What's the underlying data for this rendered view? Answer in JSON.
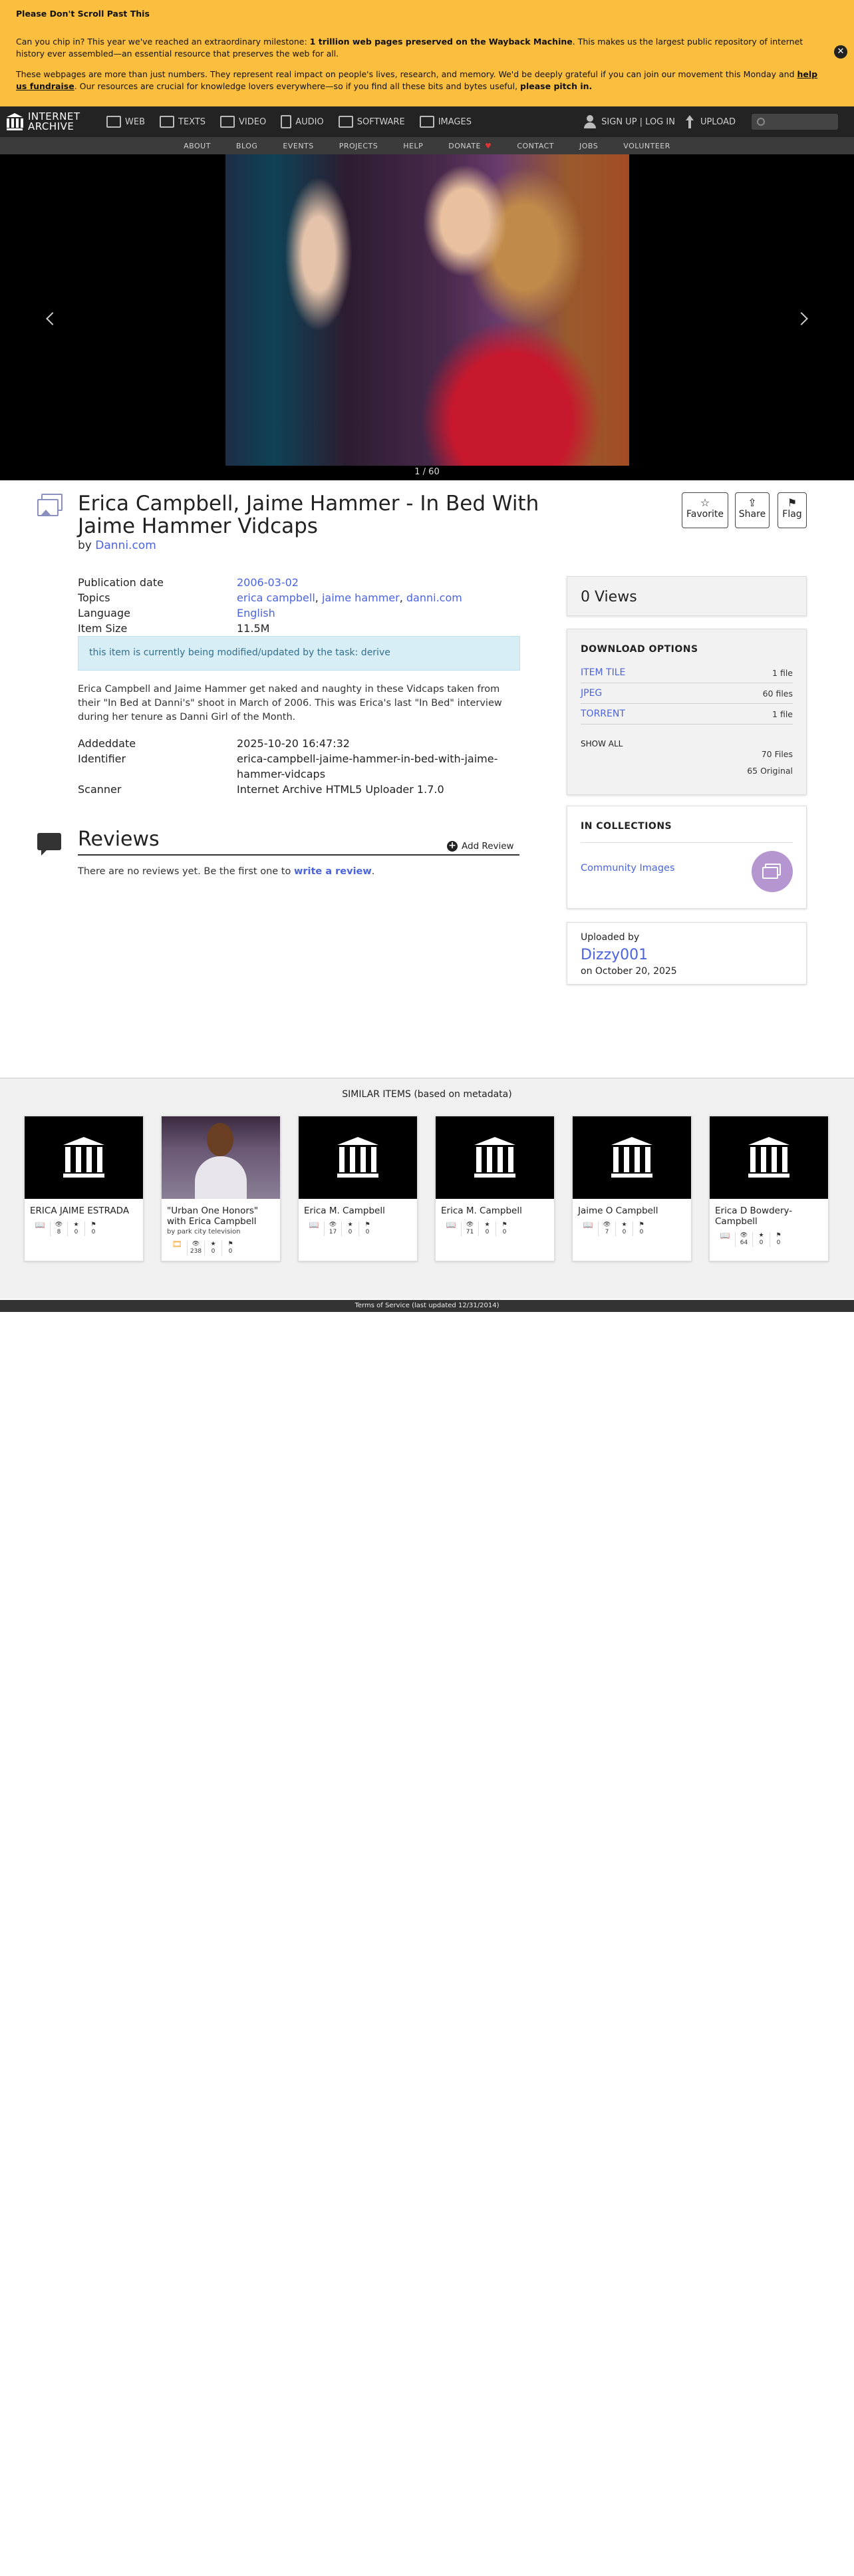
{
  "banner": {
    "title": "Please Don't Scroll Past This",
    "p1_a": "Can you chip in? This year we've reached an extraordinary milestone: ",
    "p1_b": "1 trillion web pages preserved on the Wayback Machine",
    "p1_c": ". This makes us the largest public repository of internet history ever assembled—an essential resource that preserves the web for all.",
    "p2_a": "These webpages are more than just numbers. They represent real impact on people's lives, research, and memory. We'd be deeply grateful if you can join our movement this Monday and ",
    "p2_b": "help us fundraise",
    "p2_c": ". Our resources are crucial for knowledge lovers everywhere—so if you find all these bits and bytes useful, ",
    "p2_d": "please pitch in.",
    "close": "✕"
  },
  "nav": {
    "logo_line1": "INTERNET",
    "logo_line2": "ARCHIVE",
    "items": [
      "WEB",
      "TEXTS",
      "VIDEO",
      "AUDIO",
      "SOFTWARE",
      "IMAGES"
    ],
    "signup": "SIGN UP | LOG IN",
    "upload": "UPLOAD"
  },
  "subnav": [
    "ABOUT",
    "BLOG",
    "EVENTS",
    "PROJECTS",
    "HELP",
    "DONATE",
    "CONTACT",
    "JOBS",
    "VOLUNTEER"
  ],
  "theater": {
    "counter": "1 / 60"
  },
  "item": {
    "title": "Erica Campbell, Jaime Hammer - In Bed With Jaime Hammer Vidcaps",
    "by_label": "by",
    "by_value": "Danni.com",
    "actions": {
      "favorite": "Favorite",
      "share": "Share",
      "flag": "Flag"
    }
  },
  "metadata": {
    "publication_date_label": "Publication date",
    "publication_date": "2006-03-02",
    "topics_label": "Topics",
    "topics": [
      "erica campbell",
      "jaime hammer",
      "danni.com"
    ],
    "language_label": "Language",
    "language": "English",
    "item_size_label": "Item Size",
    "item_size": "11.5M",
    "notice": "this item is currently being modified/updated by the task: derive",
    "description": "Erica Campbell and Jaime Hammer get naked and naughty in these Vidcaps taken from their \"In Bed at Danni's\" shoot in March of 2006.  This was Erica's last \"In Bed\" interview during her tenure as Danni Girl of the Month.",
    "addeddate_label": "Addeddate",
    "addeddate": "2025-10-20 16:47:32",
    "identifier_label": "Identifier",
    "identifier": "erica-campbell-jaime-hammer-in-bed-with-jaime-hammer-vidcaps",
    "scanner_label": "Scanner",
    "scanner": "Internet Archive HTML5 Uploader 1.7.0"
  },
  "reviews": {
    "title": "Reviews",
    "add": "Add Review",
    "none_text": "There are no reviews yet. Be the first one to ",
    "write_link": "write a review",
    "period": "."
  },
  "sidebar": {
    "views": "0 Views",
    "download_title": "DOWNLOAD OPTIONS",
    "downloads": [
      {
        "label": "ITEM TILE",
        "count": "1 file"
      },
      {
        "label": "JPEG",
        "count": "60 files"
      },
      {
        "label": "TORRENT",
        "count": "1 file"
      }
    ],
    "show_all": "SHOW ALL",
    "total_files": "70 Files",
    "original": "65 Original",
    "collections_title": "IN COLLECTIONS",
    "collection": "Community Images",
    "uploaded_by": "Uploaded by",
    "uploader": "Dizzy001",
    "uploaded_on": "on October 20, 2025"
  },
  "similar": {
    "heading": "SIMILAR ITEMS (based on metadata)",
    "items": [
      {
        "title": "ERICA JAIME ESTRADA",
        "sub": "",
        "thumb": "ia-logo",
        "type": "texts",
        "views": "8",
        "favs": "0",
        "reviews": "0"
      },
      {
        "title": "\"Urban One Honors\" with Erica Campbell",
        "sub": "by park city television",
        "thumb": "person",
        "type": "movies",
        "views": "238",
        "favs": "0",
        "reviews": "0"
      },
      {
        "title": "Erica M. Campbell",
        "sub": "",
        "thumb": "ia-logo",
        "type": "texts",
        "views": "17",
        "favs": "0",
        "reviews": "0"
      },
      {
        "title": "Erica M. Campbell",
        "sub": "",
        "thumb": "ia-logo",
        "type": "texts",
        "views": "71",
        "favs": "0",
        "reviews": "0"
      },
      {
        "title": "Jaime O Campbell",
        "sub": "",
        "thumb": "ia-logo",
        "type": "texts",
        "views": "7",
        "favs": "0",
        "reviews": "0"
      },
      {
        "title": "Erica D Bowdery-Campbell",
        "sub": "",
        "thumb": "ia-logo",
        "type": "texts",
        "views": "64",
        "favs": "0",
        "reviews": "0"
      }
    ]
  },
  "footer": "Terms of Service (last updated 12/31/2014)"
}
